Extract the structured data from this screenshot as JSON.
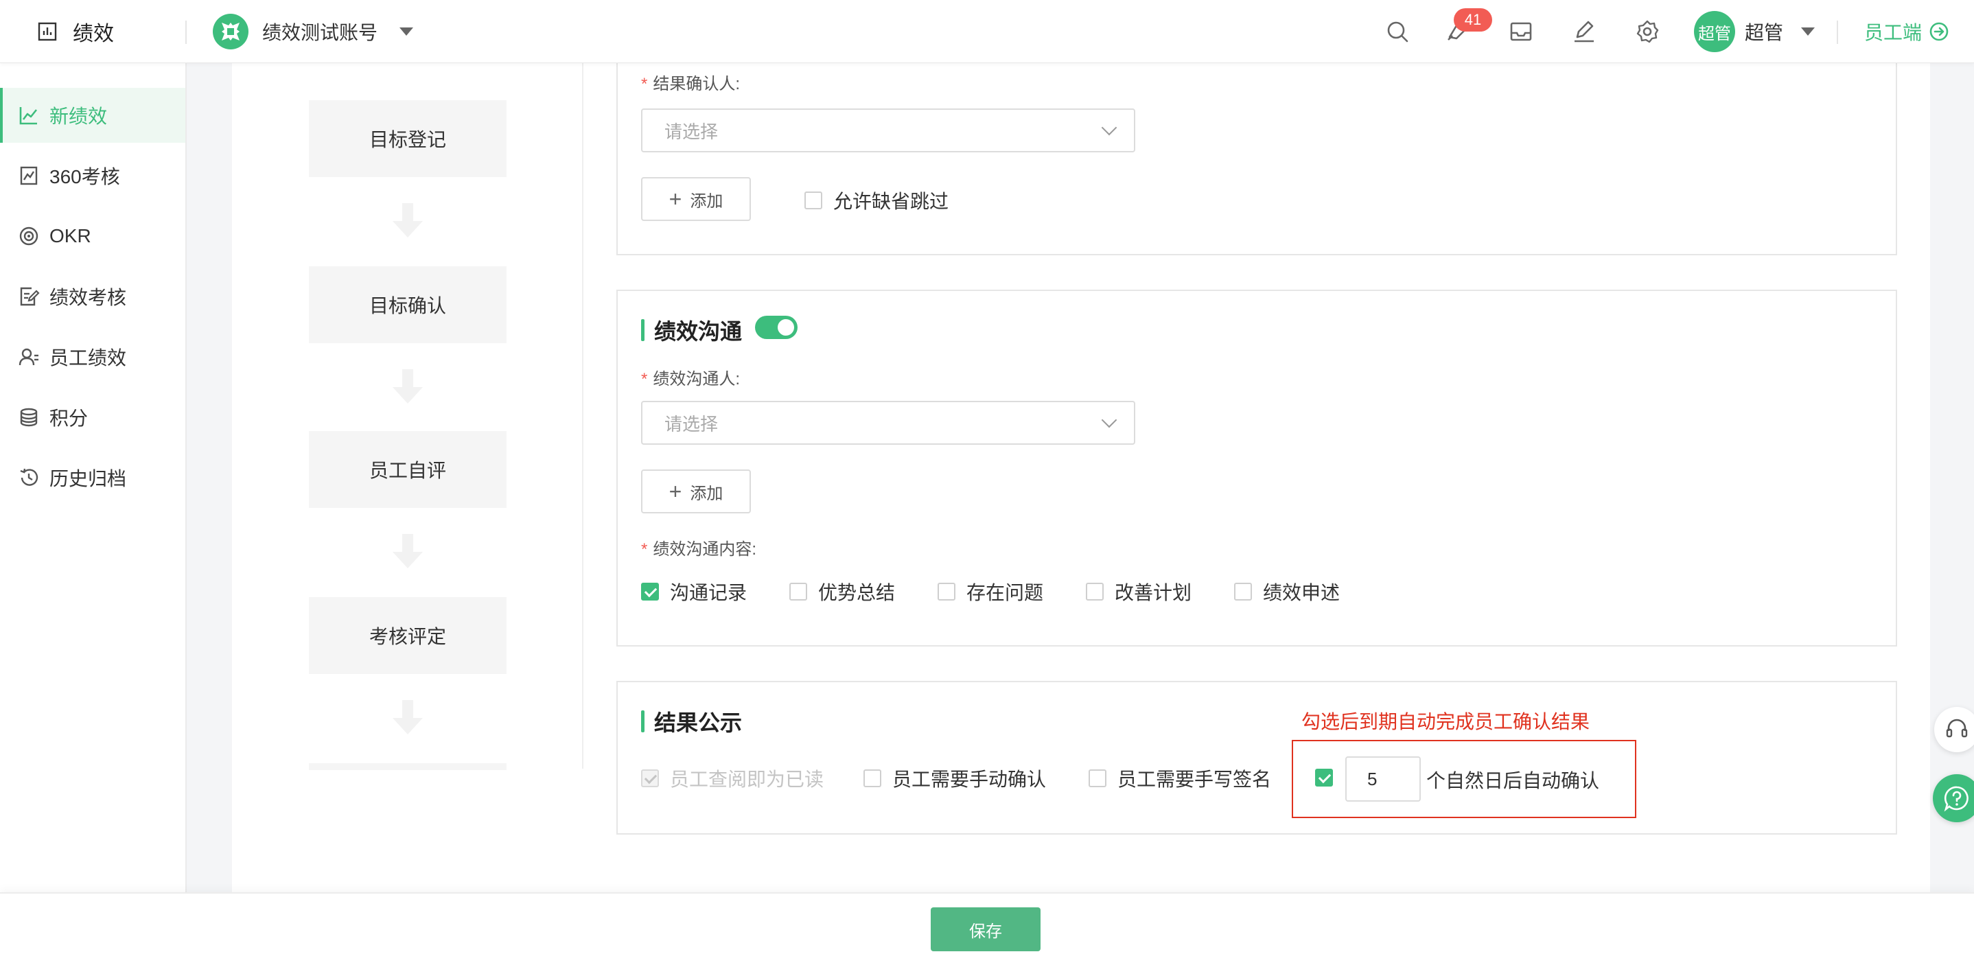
{
  "topbar": {
    "brand": "绩效",
    "account_name": "绩效测试账号",
    "notification_count": "41",
    "avatar_text": "超管",
    "user_name": "超管",
    "employee_link": "员工端"
  },
  "sidebar": {
    "items": [
      {
        "label": "新绩效",
        "icon": "line-chart-icon",
        "active": true
      },
      {
        "label": "360考核",
        "icon": "report-icon"
      },
      {
        "label": "OKR",
        "icon": "target-icon"
      },
      {
        "label": "绩效考核",
        "icon": "edit-doc-icon"
      },
      {
        "label": "员工绩效",
        "icon": "user-icon"
      },
      {
        "label": "积分",
        "icon": "coins-icon"
      },
      {
        "label": "历史归档",
        "icon": "history-icon"
      }
    ]
  },
  "flow": {
    "steps": [
      "目标登记",
      "目标确认",
      "员工自评",
      "考核评定"
    ]
  },
  "result_confirm": {
    "label": "结果确认人:",
    "placeholder": "请选择",
    "add_label": "添加",
    "allow_skip_label": "允许缺省跳过"
  },
  "communication": {
    "title": "绩效沟通",
    "enabled": true,
    "person_label": "绩效沟通人:",
    "placeholder": "请选择",
    "add_label": "添加",
    "content_label": "绩效沟通内容:",
    "options": [
      {
        "label": "沟通记录",
        "checked": true
      },
      {
        "label": "优势总结",
        "checked": false
      },
      {
        "label": "存在问题",
        "checked": false
      },
      {
        "label": "改善计划",
        "checked": false
      },
      {
        "label": "绩效申述",
        "checked": false
      }
    ]
  },
  "publish": {
    "title": "结果公示",
    "options": [
      {
        "label": "员工查阅即为已读",
        "checked": true,
        "disabled": true
      },
      {
        "label": "员工需要手动确认",
        "checked": false
      },
      {
        "label": "员工需要手写签名",
        "checked": false
      }
    ],
    "annotation": "勾选后到期自动完成员工确认结果",
    "auto_days": "5",
    "auto_label": "个自然日后自动确认",
    "auto_checked": true
  },
  "footer": {
    "save_label": "保存"
  },
  "colors": {
    "accent": "#3dbd7d",
    "badge": "#f25c54",
    "annotation": "#e0321f"
  }
}
